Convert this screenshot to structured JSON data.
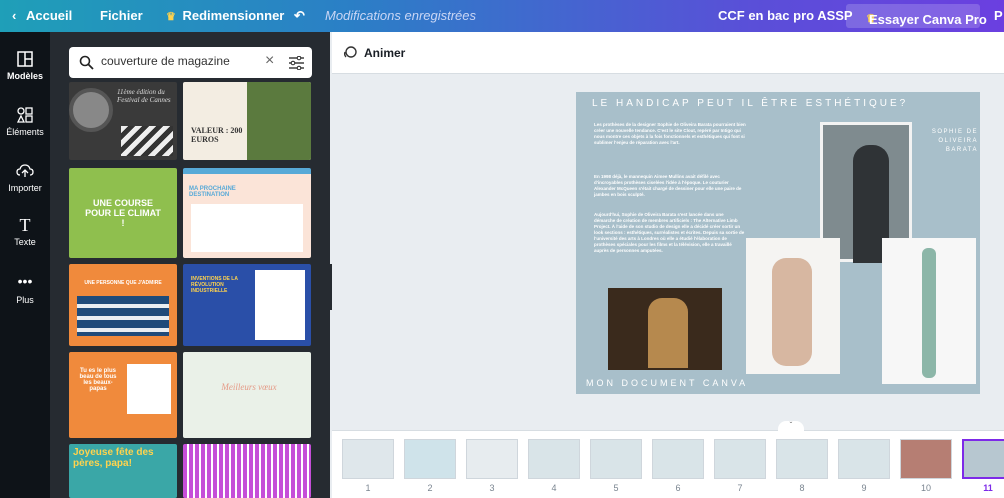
{
  "topbar": {
    "back": "Accueil",
    "file": "Fichier",
    "resize": "Redimensionner",
    "saved": "Modifications enregistrées",
    "doc_title": "CCF en bac pro ASSP",
    "try_pro": "Essayer Canva Pro",
    "extra": "P"
  },
  "nav": [
    {
      "label": "Modèles",
      "icon": "templates-icon"
    },
    {
      "label": "Éléments",
      "icon": "elements-icon"
    },
    {
      "label": "Importer",
      "icon": "upload-icon"
    },
    {
      "label": "Texte",
      "icon": "text-icon"
    },
    {
      "label": "Plus",
      "icon": "more-icon"
    }
  ],
  "search": {
    "value": "couverture de magazine"
  },
  "thumbs": {
    "t1_a": "11ème édition du Festival de Cannes",
    "t1_b": "VALEUR : 200 EUROS",
    "t2_a": "UNE COURSE POUR LE CLIMAT !",
    "t2_b": "MA PROCHAINE DESTINATION",
    "t3_a": "UNE PERSONNE QUE J'ADMIRE",
    "t3_b": "INVENTIONS DE LA RÉVOLUTION INDUSTRIELLE",
    "t4_a": "Tu es le plus beau de tous les beaux-papas",
    "t4_b": "Meilleurs vœux",
    "t5_a": "Joyeuse fête des pères, papa!"
  },
  "editor": {
    "animate": "Animer"
  },
  "design": {
    "title": "LE HANDICAP PEUT IL ÊTRE ESTHÉTIQUE?",
    "author": "SOPHIE DE OLIVEIRA BARATA",
    "footer": "MON DOCUMENT CANVA",
    "p1": "Les prothèses de la designer Sophie de Oliveira Barata pourraient bien créer une nouvelle tendance. C'est le site Clout, repéré par Intigo qui nous montre ces objets à la fois fonctionnels et esthétiques qui font si sublimer l'enjeu de réparation avec l'art.",
    "p2": "En 1998 déjà, le mannequin Aimee Mullins avait défilé avec d'incroyables prothèses ciselées l'idée à l'époque. Le couturier Alexander McQueen s'était chargé de dessiner pour elle une paire de jambes en bois sculpté.",
    "p3": "Aujourd'hui, Sophie de Oliveira Barata s'est lancée dans une démarche de création de membres artificiels : The Alternative Limb Project. À l'aide de son studio de design elle a décidé créer sortir un look sections : esthétiques, surréalistes et écrites. Depuis sa sortie de l'université des arts à Londres où elle a étudié l'élaboration de prothèses spéciales pour les films et la télévision, elle a travaillé auprès de personnes amputées."
  },
  "pages": [
    "1",
    "2",
    "3",
    "4",
    "5",
    "6",
    "7",
    "8",
    "9",
    "10",
    "11"
  ],
  "colors": {
    "accent": "#7d2ae8",
    "design_bg": "#a8bfca"
  }
}
